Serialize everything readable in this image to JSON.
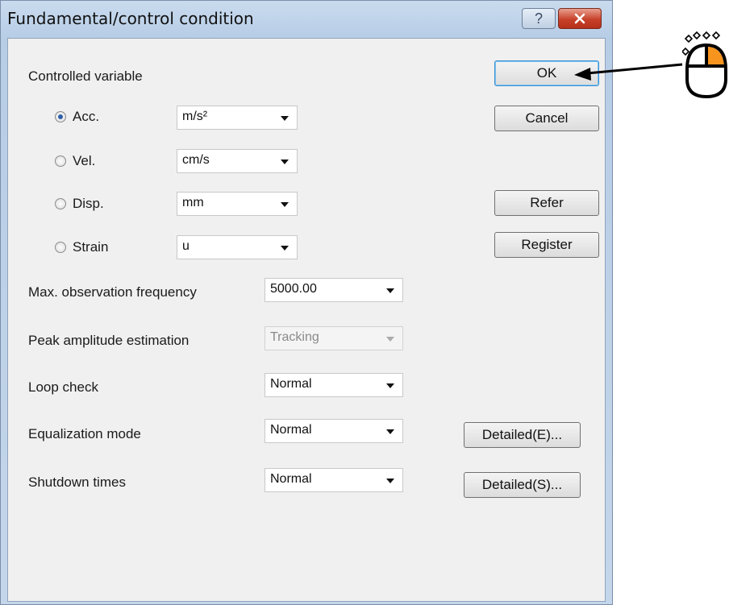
{
  "dialog": {
    "title": "Fundamental/control condition",
    "help_glyph": "?",
    "close_glyph": "✕"
  },
  "controlled_variable": {
    "label": "Controlled variable",
    "options": [
      {
        "label": "Acc.",
        "unit": "m/s²",
        "selected": true
      },
      {
        "label": "Vel.",
        "unit": "cm/s",
        "selected": false
      },
      {
        "label": "Disp.",
        "unit": "mm",
        "selected": false
      },
      {
        "label": "Strain",
        "unit": "u",
        "selected": false
      }
    ]
  },
  "settings": [
    {
      "label": "Max. observation frequency",
      "value": "5000.00",
      "enabled": true
    },
    {
      "label": "Peak amplitude estimation",
      "value": "Tracking",
      "enabled": false
    },
    {
      "label": "Loop check",
      "value": "Normal",
      "enabled": true
    },
    {
      "label": "Equalization mode",
      "value": "Normal",
      "enabled": true
    },
    {
      "label": "Shutdown times",
      "value": "Normal",
      "enabled": true
    }
  ],
  "buttons": {
    "ok": "OK",
    "cancel": "Cancel",
    "refer": "Refer",
    "register": "Register",
    "detailed_e": "Detailed(E)...",
    "detailed_s": "Detailed(S)..."
  },
  "annotation": {
    "icon": "mouse-left-click-icon",
    "accent_color": "#f7941d"
  }
}
